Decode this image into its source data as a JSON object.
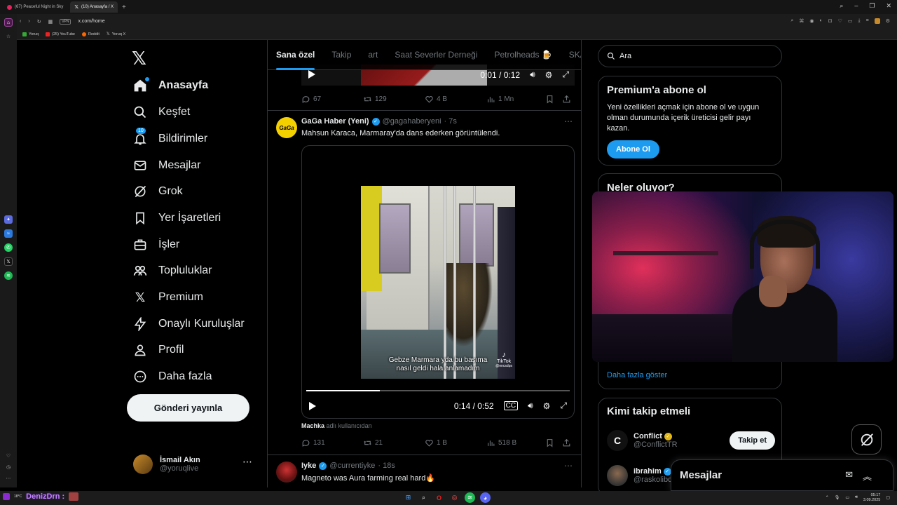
{
  "browser": {
    "tabs": [
      {
        "label": "(67) Peaceful Night in Sky",
        "color": "#e0245e",
        "active": false
      },
      {
        "label": "(10) Anasayfa / X",
        "color": "#ffffff",
        "active": true
      }
    ],
    "url": "x.com/home",
    "vpn_label": "VPN",
    "bookmarks": [
      "Yoruq",
      "(25) YouTube",
      "Reddit",
      "Yoruq X"
    ]
  },
  "x": {
    "nav": [
      {
        "label": "Anasayfa",
        "icon": "home-icon",
        "active": true
      },
      {
        "label": "Keşfet",
        "icon": "search-icon"
      },
      {
        "label": "Bildirimler",
        "icon": "bell-icon",
        "badge": "10"
      },
      {
        "label": "Mesajlar",
        "icon": "mail-icon"
      },
      {
        "label": "Grok",
        "icon": "grok-icon"
      },
      {
        "label": "Yer İşaretleri",
        "icon": "bookmark-icon"
      },
      {
        "label": "İşler",
        "icon": "briefcase-icon"
      },
      {
        "label": "Topluluklar",
        "icon": "people-icon"
      },
      {
        "label": "Premium",
        "icon": "x-icon"
      },
      {
        "label": "Onaylı Kuruluşlar",
        "icon": "lightning-icon"
      },
      {
        "label": "Profil",
        "icon": "person-icon"
      },
      {
        "label": "Daha fazla",
        "icon": "more-circle-icon"
      }
    ],
    "post_button": "Gönderi yayınla",
    "account": {
      "name": "İsmail Akın",
      "handle": "@yoruqlive"
    },
    "top_tabs": [
      "Sana özel",
      "Takip",
      "art",
      "Saat Severler Derneği",
      "Petrolheads 🍺",
      "SKA"
    ],
    "prev_tweet": {
      "time": "0:01 / 0:12",
      "replies": "67",
      "reposts": "129",
      "likes": "4 B",
      "views": "1 Mn"
    },
    "tweet": {
      "name": "GaGa Haber (Yeni)",
      "handle": "@gagahaberyeni",
      "age": "· 7s",
      "text": "Mahsun Karaca, Marmaray'da dans ederken görüntülendi.",
      "caption_line1": "Gebze Marmara yda bu başıma",
      "caption_line2": "nasıl geldi hala anlamadım",
      "tiktok_label": "TikTok",
      "tiktok_user": "@encsdps",
      "time": "0:14 / 0:52",
      "progress": 0.28,
      "attribution_user": "Machka",
      "attribution_suffix": " adlı kullanıcıdan",
      "replies": "131",
      "reposts": "21",
      "likes": "1 B",
      "views": "518 B",
      "avatar_text": "GaGa"
    },
    "next_tweet": {
      "name": "Iyke",
      "handle": "@currentiyke",
      "age": "· 18s",
      "text": "Magneto was Aura farming real hard🔥"
    },
    "search_placeholder": "Ara",
    "premium": {
      "title": "Premium'a abone ol",
      "body": "Yeni özellikleri açmak için abone ol ve uygun olman durumunda içerik üreticisi gelir payı kazan.",
      "button": "Abone Ol"
    },
    "trends": {
      "title": "Neler oluyor?",
      "more": "Daha fazla göster"
    },
    "who_to_follow": {
      "title": "Kimi takip etmeli",
      "accounts": [
        {
          "name": "Conflict",
          "handle": "@ConflictTR",
          "button": "Takip et"
        },
        {
          "name": "ibrahim",
          "handle": "@raskolibo"
        }
      ]
    },
    "messages_drawer": "Mesajlar"
  },
  "taskbar": {
    "weather": "18°C",
    "streamer": "DenizDrn :",
    "time": "05:17",
    "date": "3.09.2025"
  },
  "colors": {
    "accent": "#1d9bf0",
    "bg": "#000000",
    "muted": "#71767b",
    "border": "#2f3336"
  }
}
